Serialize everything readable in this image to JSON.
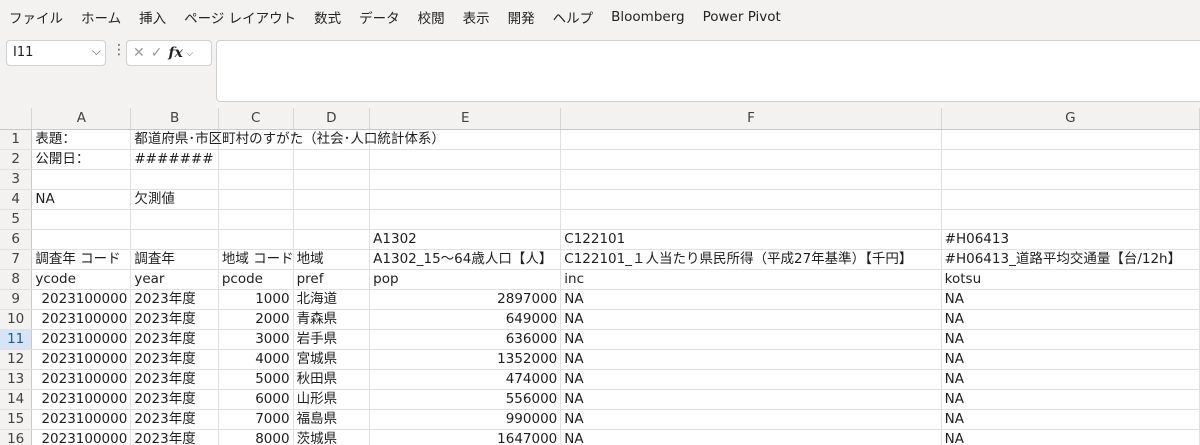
{
  "ribbon": {
    "tabs": [
      "ファイル",
      "ホーム",
      "挿入",
      "ページ レイアウト",
      "数式",
      "データ",
      "校閲",
      "表示",
      "開発",
      "ヘルプ",
      "Bloomberg",
      "Power Pivot"
    ]
  },
  "formula_bar": {
    "name_box": "I11",
    "cancel_symbol": "✕",
    "enter_symbol": "✓",
    "fx_label": "fx",
    "formula": ""
  },
  "sheet": {
    "columns": [
      "A",
      "B",
      "C",
      "D",
      "E",
      "F",
      "G"
    ],
    "selected_row": "11",
    "rows": [
      {
        "n": "1",
        "a": "表題：",
        "b": "都道府県･市区町村のすがた（社会･人口統計体系）",
        "c": "",
        "d": "",
        "e": "",
        "f": "",
        "g": ""
      },
      {
        "n": "2",
        "a": "公開日：",
        "b": "#######",
        "c": "",
        "d": "",
        "e": "",
        "f": "",
        "g": ""
      },
      {
        "n": "3",
        "a": "",
        "b": "",
        "c": "",
        "d": "",
        "e": "",
        "f": "",
        "g": ""
      },
      {
        "n": "4",
        "a": "NA",
        "b": "欠測値",
        "c": "",
        "d": "",
        "e": "",
        "f": "",
        "g": ""
      },
      {
        "n": "5",
        "a": "",
        "b": "",
        "c": "",
        "d": "",
        "e": "",
        "f": "",
        "g": ""
      },
      {
        "n": "6",
        "a": "",
        "b": "",
        "c": "",
        "d": "",
        "e": "A1302",
        "f": "C122101",
        "g": "#H06413"
      },
      {
        "n": "7",
        "a": "調査年 コード",
        "b": "調査年",
        "c": "地域 コード",
        "d": "地域",
        "e": "A1302_15～64歳人口【人】",
        "f": "C122101_１人当たり県民所得（平成27年基準）【千円】",
        "g": "#H06413_道路平均交通量【台/12h】"
      },
      {
        "n": "8",
        "a": "ycode",
        "b": "year",
        "c": "pcode",
        "d": "pref",
        "e": "pop",
        "f": "inc",
        "g": "kotsu"
      },
      {
        "n": "9",
        "a": "2023100000",
        "b": "2023年度",
        "c": "1000",
        "d": "北海道",
        "e": "2897000",
        "f": "NA",
        "g": "NA"
      },
      {
        "n": "10",
        "a": "2023100000",
        "b": "2023年度",
        "c": "2000",
        "d": "青森県",
        "e": "649000",
        "f": "NA",
        "g": "NA"
      },
      {
        "n": "11",
        "a": "2023100000",
        "b": "2023年度",
        "c": "3000",
        "d": "岩手県",
        "e": "636000",
        "f": "NA",
        "g": "NA"
      },
      {
        "n": "12",
        "a": "2023100000",
        "b": "2023年度",
        "c": "4000",
        "d": "宮城県",
        "e": "1352000",
        "f": "NA",
        "g": "NA"
      },
      {
        "n": "13",
        "a": "2023100000",
        "b": "2023年度",
        "c": "5000",
        "d": "秋田県",
        "e": "474000",
        "f": "NA",
        "g": "NA"
      },
      {
        "n": "14",
        "a": "2023100000",
        "b": "2023年度",
        "c": "6000",
        "d": "山形県",
        "e": "556000",
        "f": "NA",
        "g": "NA"
      },
      {
        "n": "15",
        "a": "2023100000",
        "b": "2023年度",
        "c": "7000",
        "d": "福島県",
        "e": "990000",
        "f": "NA",
        "g": "NA"
      },
      {
        "n": "16",
        "a": "2023100000",
        "b": "2023年度",
        "c": "8000",
        "d": "茨城県",
        "e": "1647000",
        "f": "NA",
        "g": "NA"
      }
    ]
  }
}
